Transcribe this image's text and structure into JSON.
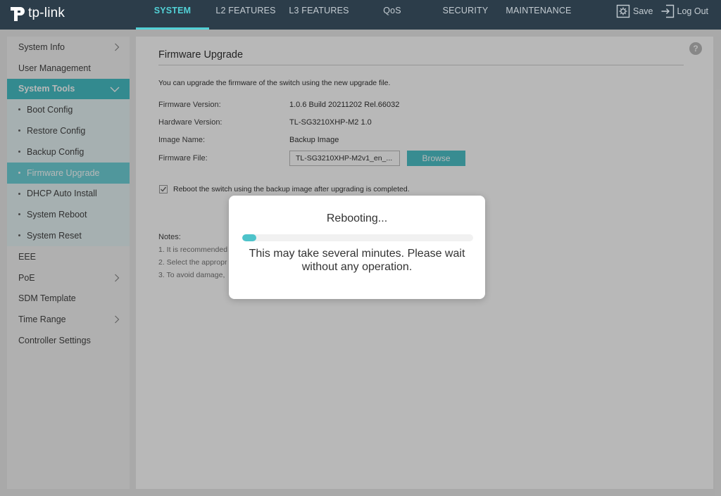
{
  "brand": {
    "name": "tp-link",
    "accent": "#4ec3ca",
    "topbar_bg": "#2c3d4a"
  },
  "nav": {
    "items": [
      {
        "label": "SYSTEM",
        "active": true
      },
      {
        "label": "L2 FEATURES",
        "active": false
      },
      {
        "label": "L3 FEATURES",
        "active": false
      },
      {
        "label": "QoS",
        "active": false
      },
      {
        "label": "SECURITY",
        "active": false
      },
      {
        "label": "MAINTENANCE",
        "active": false
      }
    ],
    "save_label": "Save",
    "save_icon": "save-icon",
    "logout_label": "Log Out",
    "logout_icon": "logout-icon"
  },
  "sidebar": {
    "items": [
      {
        "label": "System Info",
        "chevron": "right"
      },
      {
        "label": "User Management"
      },
      {
        "label": "System Tools",
        "chevron": "down",
        "expanded": true
      },
      {
        "label": "Boot Config"
      },
      {
        "label": "Restore Config"
      },
      {
        "label": "Backup Config"
      },
      {
        "label": "Firmware Upgrade",
        "active": true
      },
      {
        "label": "DHCP Auto Install"
      },
      {
        "label": "System Reboot"
      },
      {
        "label": "System Reset"
      },
      {
        "label": "EEE"
      },
      {
        "label": "PoE",
        "chevron": "right"
      },
      {
        "label": "SDM Template"
      },
      {
        "label": "Time Range",
        "chevron": "right"
      },
      {
        "label": "Controller Settings"
      }
    ]
  },
  "main": {
    "title": "Firmware Upgrade",
    "help_icon": "help-icon",
    "description": "You can upgrade the firmware of the switch using the new upgrade file.",
    "rows": [
      {
        "label": "Firmware Version:",
        "value": "1.0.6 Build 20211202 Rel.66032"
      },
      {
        "label": "Hardware Version:",
        "value": "TL-SG3210XHP-M2 1.0"
      },
      {
        "label": "Image Name:",
        "value": "Backup Image"
      }
    ],
    "firmware_file_label": "Firmware File:",
    "firmware_file_value": "TL-SG3210XHP-M2v1_en_...",
    "browse_label": "Browse",
    "reboot_checkbox_checked": true,
    "reboot_checkbox_label": "Reboot the switch using the backup image after upgrading is completed.",
    "notes_title": "Notes:",
    "notes": [
      "1. It is recommended",
      "2. Select the appropr",
      "3. To avoid damage,"
    ]
  },
  "modal": {
    "title": "Rebooting...",
    "progress_fraction": 0.06,
    "message": "This may take several minutes. Please wait without any operation."
  }
}
